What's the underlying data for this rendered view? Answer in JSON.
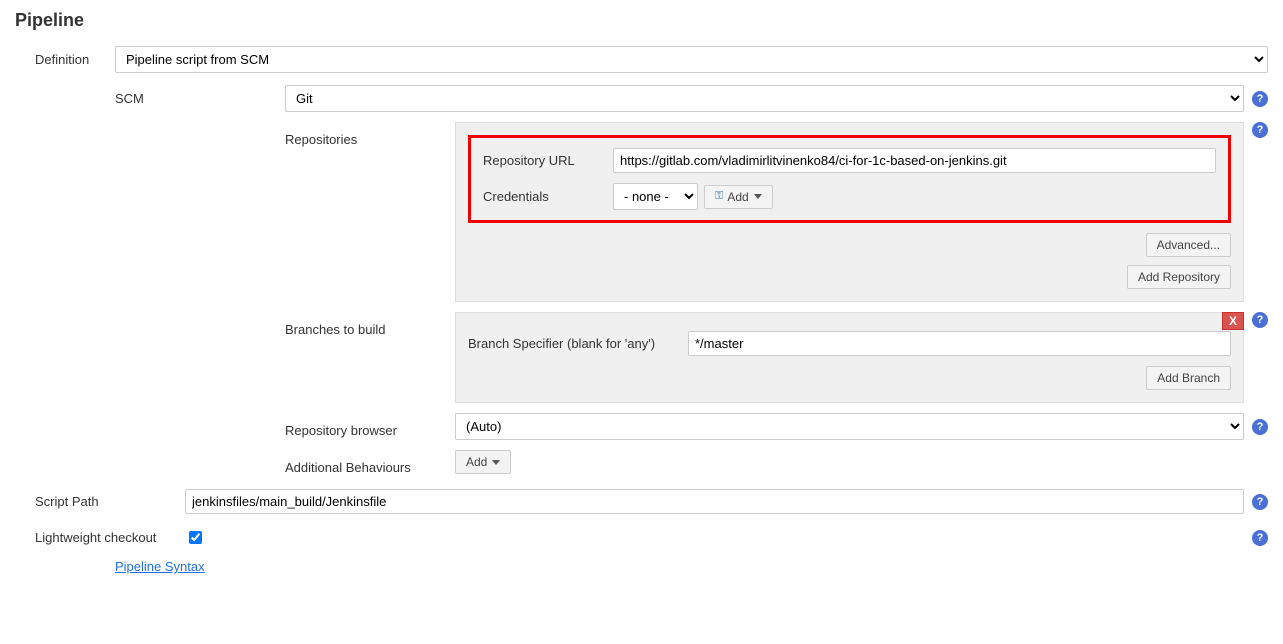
{
  "section_title": "Pipeline",
  "labels": {
    "definition": "Definition",
    "scm": "SCM",
    "repositories": "Repositories",
    "repository_url": "Repository URL",
    "credentials": "Credentials",
    "branches_to_build": "Branches to build",
    "branch_specifier": "Branch Specifier (blank for 'any')",
    "repository_browser": "Repository browser",
    "additional_behaviours": "Additional Behaviours",
    "script_path": "Script Path",
    "lightweight_checkout": "Lightweight checkout"
  },
  "definition_selected": "Pipeline script from SCM",
  "scm_selected": "Git",
  "repository_url_value": "https://gitlab.com/vladimirlitvinenko84/ci-for-1c-based-on-jenkins.git",
  "credentials_selected": "- none -",
  "buttons": {
    "add_dropdown": "Add",
    "advanced": "Advanced...",
    "add_repository": "Add Repository",
    "add_branch": "Add Branch",
    "add": "Add"
  },
  "branch_specifier_value": "*/master",
  "repository_browser_selected": "(Auto)",
  "script_path_value": "jenkinsfiles/main_build/Jenkinsfile",
  "lightweight_checkout_checked": true,
  "pipeline_syntax_link": "Pipeline Syntax",
  "close_x": "X",
  "help_glyph": "?"
}
